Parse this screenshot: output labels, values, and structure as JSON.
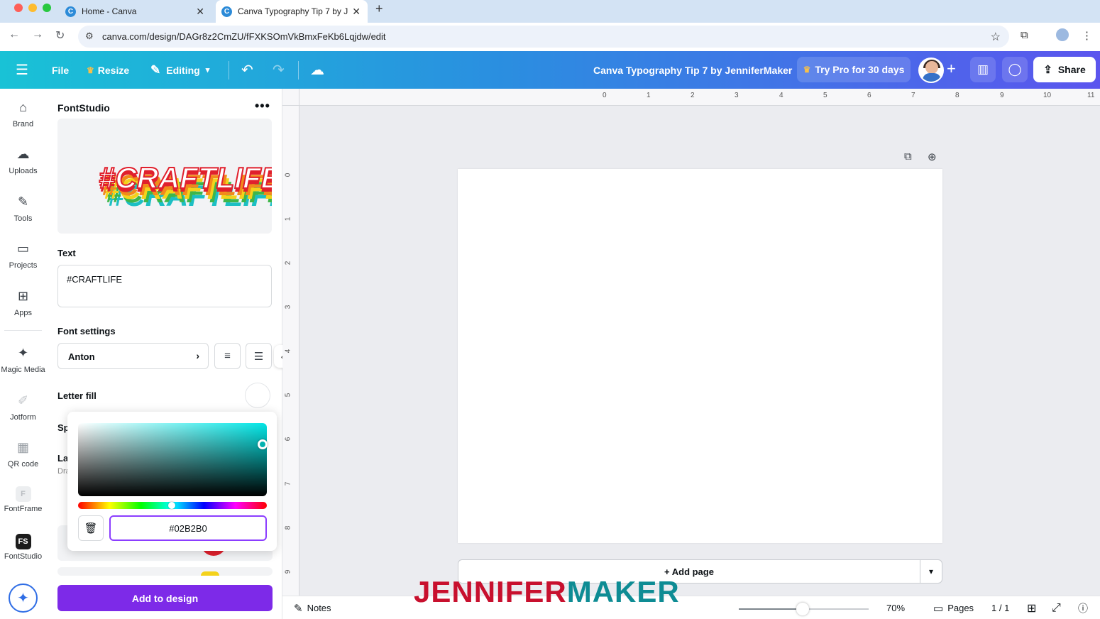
{
  "browser": {
    "tabs": [
      {
        "title": "Home - Canva",
        "favicon": "C"
      },
      {
        "title": "Canva Typography Tip 7 by J",
        "favicon": "C"
      }
    ],
    "close_glyph": "✕",
    "new_tab_glyph": "+",
    "url": "canva.com/design/DAGr8z2CmZU/fFXKSOmVkBmxFeKb6Lqjdw/edit"
  },
  "toolbar": {
    "file_label": "File",
    "resize_label": "Resize",
    "editing_label": "Editing",
    "design_title": "Canva Typography Tip 7 by JenniferMaker",
    "pro_label": "Try Pro for 30 days",
    "share_label": "Share"
  },
  "rail": {
    "items": [
      {
        "label": "Brand"
      },
      {
        "label": "Uploads"
      },
      {
        "label": "Tools"
      },
      {
        "label": "Projects"
      },
      {
        "label": "Apps"
      },
      {
        "label": "Magic Media"
      },
      {
        "label": "Jotform"
      },
      {
        "label": "QR code"
      },
      {
        "label": "FontFrame"
      },
      {
        "label": "FontStudio"
      }
    ],
    "fontstudio_tile": "FS"
  },
  "panel": {
    "title": "FontStudio",
    "preview_text": "#CRAFTLIFE",
    "text_label": "Text",
    "text_value": "#CRAFTLIFE",
    "font_settings_label": "Font settings",
    "font_name": "Anton",
    "letter_fill_label": "Letter fill",
    "cut_label_1": "Sp",
    "cut_label_2": "La",
    "cut_label_3": "Dra",
    "add_button": "Add to design"
  },
  "color_picker": {
    "hex_value": "#02B2B0",
    "selected_color": "#02B2B0"
  },
  "canvas": {
    "ruler_h": [
      "0",
      "1",
      "2",
      "3",
      "4",
      "5",
      "6",
      "7",
      "8",
      "9",
      "10",
      "11"
    ],
    "ruler_v": [
      "0",
      "1",
      "2",
      "3",
      "4",
      "5",
      "6",
      "7",
      "8",
      "9"
    ],
    "add_page_label": "+ Add page"
  },
  "bottombar": {
    "notes_label": "Notes",
    "zoom": "70%",
    "pages_label": "Pages",
    "page_count": "1 / 1"
  },
  "watermark": {
    "part1": "JENNIFER",
    "part2": "MAKER"
  },
  "colors": {
    "accent_purple": "#7d2ae8",
    "header_gradient_start": "#19c2d6",
    "header_gradient_end": "#5b55ee",
    "watermark_red": "#c8102e",
    "watermark_teal": "#0e8c94"
  }
}
